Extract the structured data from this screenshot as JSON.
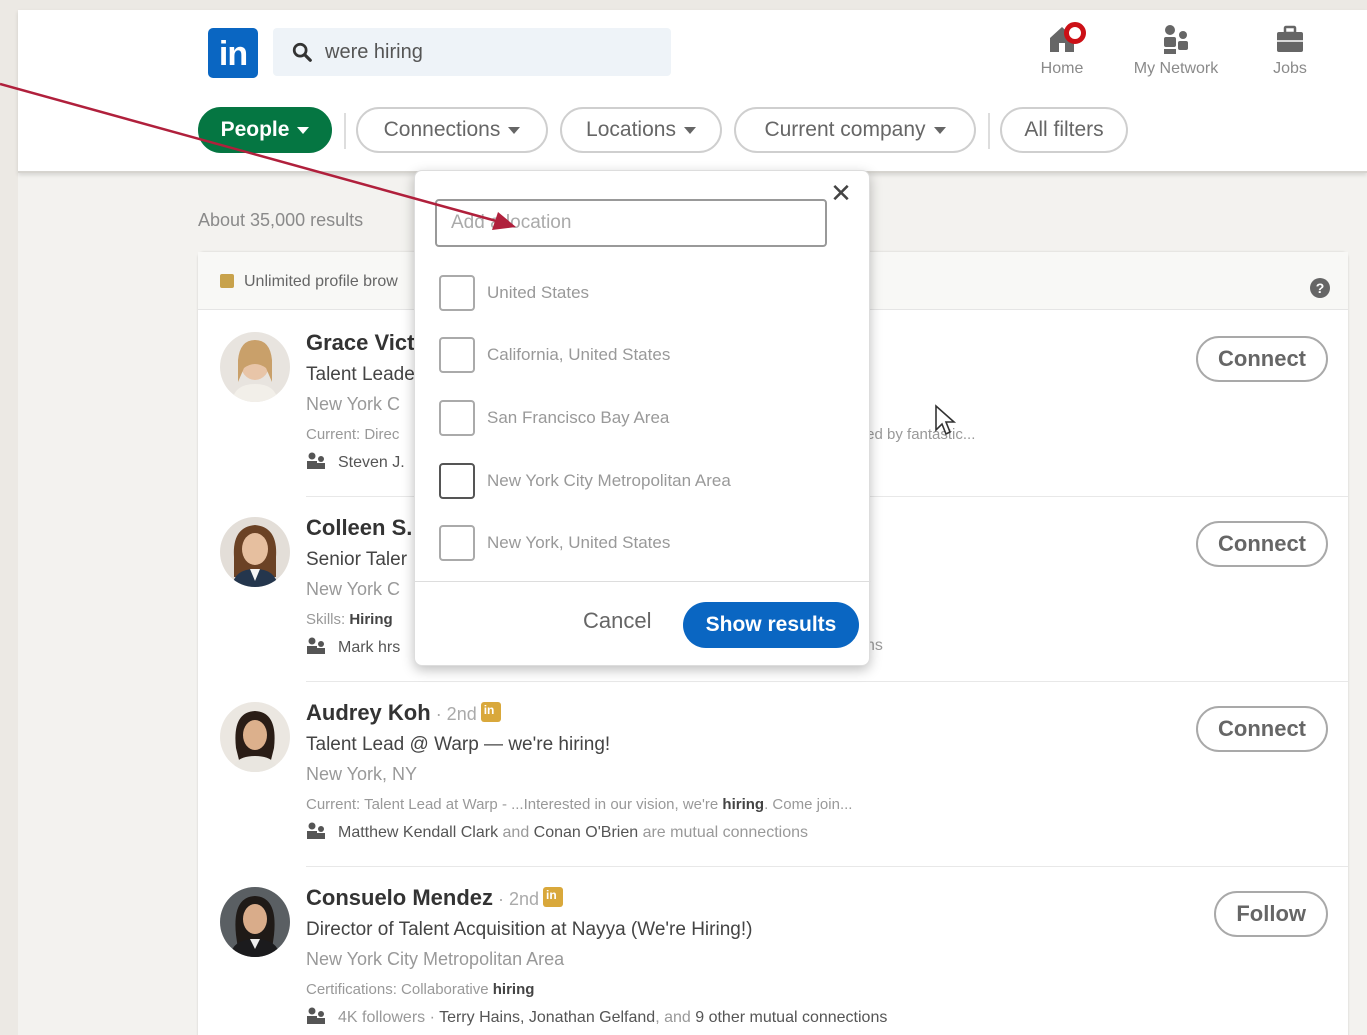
{
  "nav": {
    "logo": "in",
    "search_value": "were hiring",
    "items": [
      {
        "label": "Home",
        "icon": "home-icon"
      },
      {
        "label": "My Network",
        "icon": "network-icon"
      },
      {
        "label": "Jobs",
        "icon": "briefcase-icon"
      }
    ]
  },
  "filters": {
    "people": "People",
    "connections": "Connections",
    "locations": "Locations",
    "current_company": "Current company",
    "all_filters": "All filters"
  },
  "results": {
    "count": "About 35,000 results",
    "premium_text": "Unlimited profile brow"
  },
  "people": [
    {
      "name": "Grace Vict",
      "degree": "",
      "headline": "Talent Leade",
      "location": "New York C",
      "snippet_prefix": "Current: Direc",
      "snippet_bold": "",
      "snippet_suffix": "ted by fantastic...",
      "mutual_bold": "Steven J.",
      "mutual_rest": "",
      "action": "Connect"
    },
    {
      "name": "Colleen S.",
      "degree": "",
      "headline": "Senior Taler",
      "location": "New York C",
      "snippet_prefix": "Skills: ",
      "snippet_bold": "Hiring",
      "snippet_suffix": "",
      "mutual_bold": "Mark hrs",
      "mutual_rest": "ns",
      "action": "Connect"
    },
    {
      "name": "Audrey Koh",
      "degree": " · 2nd",
      "headline": "Talent Lead @ Warp — we're hiring!",
      "location": "New York, NY",
      "snippet_prefix": "Current: Talent Lead at Warp - ...Interested in our vision, we're ",
      "snippet_bold": "hiring",
      "snippet_suffix": ". Come join...",
      "mutual_bold": "Matthew Kendall Clark",
      "mutual_and": " and ",
      "mutual_bold2": "Conan O'Brien",
      "mutual_rest": " are mutual connections",
      "action": "Connect"
    },
    {
      "name": "Consuelo Mendez",
      "degree": " · 2nd",
      "headline": "Director of Talent Acquisition at Nayya (We're Hiring!)",
      "location": "New York City Metropolitan Area",
      "snippet_prefix": "Certifications: Collaborative ",
      "snippet_bold": "hiring",
      "snippet_suffix": "",
      "mutual_pre": "4K followers · ",
      "mutual_bold": "Terry Hains, Jonathan Gelfand",
      "mutual_and": ", and ",
      "mutual_bold2": "9 other mutual connections",
      "mutual_rest": "",
      "action": "Follow"
    }
  ],
  "location_dropdown": {
    "placeholder": "Add a location",
    "options": [
      "United States",
      "California, United States",
      "San Francisco Bay Area",
      "New York City Metropolitan Area",
      "New York, United States"
    ],
    "cancel": "Cancel",
    "show_results": "Show results"
  },
  "colors": {
    "brand": "#0a66c2",
    "people_pill": "#057642",
    "annotation_arrow": "#b0203c",
    "notification": "#cc1016"
  }
}
